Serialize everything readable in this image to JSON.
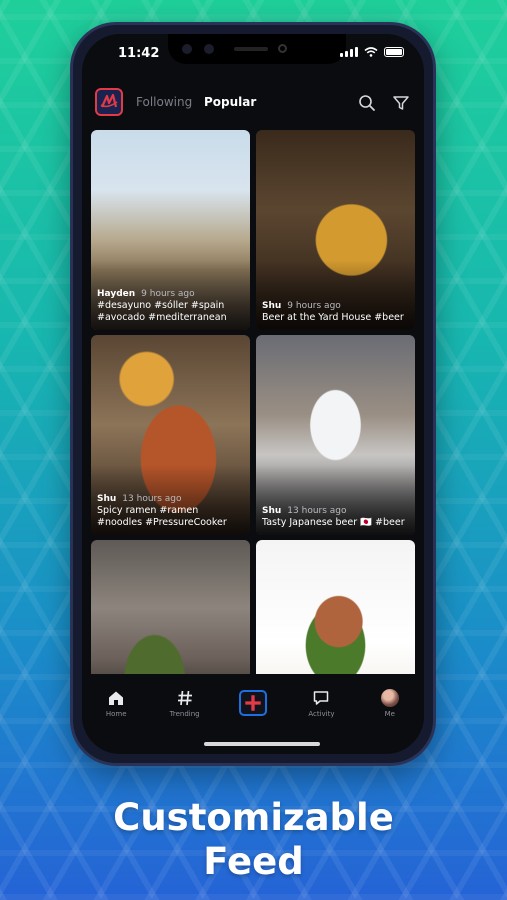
{
  "status_bar": {
    "time": "11:42"
  },
  "header": {
    "tabs": [
      {
        "label": "Following",
        "active": false
      },
      {
        "label": "Popular",
        "active": true
      }
    ],
    "icons": [
      "search-icon",
      "filter-icon"
    ],
    "logo_color": "#e23a46"
  },
  "feed": {
    "posts": [
      {
        "user": "Hayden",
        "time_ago": "9 hours ago",
        "caption": "#desayuno #sóller #spain #avocado #mediterranean",
        "image": "breakfast-terrace-photo"
      },
      {
        "user": "Shu",
        "time_ago": "9 hours ago",
        "caption": "Beer at the Yard House #beer",
        "image": "beer-glass-photo"
      },
      {
        "user": "Shu",
        "time_ago": "13 hours ago",
        "caption": "Spicy ramen #ramen #noodles #PressureCooker",
        "image": "ramen-photo"
      },
      {
        "user": "Shu",
        "time_ago": "13 hours ago",
        "caption": "Tasty Japanese beer 🇯🇵 #beer",
        "image": "sapporo-pour-photo"
      },
      {
        "user": "",
        "time_ago": "",
        "caption": "",
        "image": "wok-cooking-photo"
      },
      {
        "user": "",
        "time_ago": "",
        "caption": "",
        "image": "plated-fish-photo"
      }
    ]
  },
  "tab_bar": {
    "items": [
      {
        "label": "Home",
        "icon": "home-icon"
      },
      {
        "label": "Trending",
        "icon": "hashtag-icon"
      },
      {
        "label": "",
        "icon": "add-icon"
      },
      {
        "label": "Activity",
        "icon": "chat-icon"
      },
      {
        "label": "Me",
        "icon": "avatar"
      }
    ],
    "accent": "#1d6fe0",
    "add_color": "#e23a46"
  },
  "promo": {
    "line1": "Customizable",
    "line2": "Feed"
  }
}
